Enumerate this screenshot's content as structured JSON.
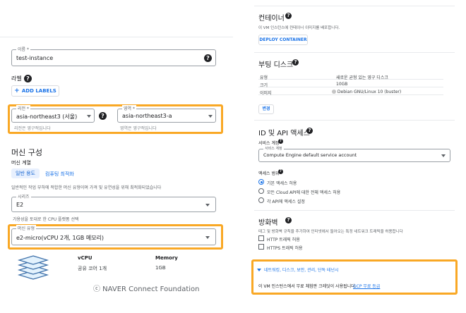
{
  "instance": {
    "name_label": "이름 *",
    "name_value": "test-instance"
  },
  "labels": {
    "title": "라벨",
    "add_button": "ADD LABELS"
  },
  "location": {
    "region_label": "리전 *",
    "region_value": "asia-northeast3 (서울)",
    "region_hint": "리전은 영구적입니다",
    "zone_label": "영역 *",
    "zone_value": "asia-northeast3-a",
    "zone_hint": "영역은 영구적입니다"
  },
  "machine": {
    "section_title": "머신 구성",
    "family_label": "머신 계열",
    "tabs": [
      {
        "label": "일반 용도",
        "selected": true
      },
      {
        "label": "컴퓨팅 최적화",
        "selected": false
      }
    ],
    "family_desc": "일반적인 작업 부하에 적합한 머신 유형이며 가격 및 유연성을 위해 최적화되었습니다",
    "series_label": "시리즈",
    "series_value": "E2",
    "series_desc": "가용성을 토대로 한 CPU 플랫폼 선택",
    "type_label": "머신 유형",
    "type_value": "e2-micro(vCPU 2개, 1GB 메모리)",
    "vcpu_header": "vCPU",
    "vcpu_value": "공유 코어 1개",
    "memory_header": "Memory",
    "memory_value": "1GB"
  },
  "credit": "ⓒ  NAVER Connect Foundation",
  "container": {
    "title": "컨테이너",
    "desc": "이 VM 인스턴스에 컨테이너 이미지를 배포합니다.",
    "deploy_button": "DEPLOY CONTAINER"
  },
  "boot_disk": {
    "title": "부팅 디스크",
    "rows": [
      {
        "key": "유형",
        "value": "새로운 균형 있는 영구 디스크"
      },
      {
        "key": "크기",
        "value": "10GB"
      },
      {
        "key": "이미지",
        "value": "Debian GNU/Linux 10 (buster)"
      }
    ],
    "change_button": "변경"
  },
  "identity": {
    "title": "ID 및 API 액세스",
    "service_account_heading": "서비스 계정",
    "service_account_label": "서비스 계정",
    "service_account_value": "Compute Engine default service account",
    "scope_heading": "액세스 범위",
    "scopes": [
      {
        "label": "기본 액세스 허용",
        "selected": true
      },
      {
        "label": "모든 Cloud API에 대한 전체 액세스 허용",
        "selected": false
      },
      {
        "label": "각 API에 액세스 설정",
        "selected": false
      }
    ]
  },
  "firewall": {
    "title": "방화벽",
    "desc": "태그 및 방화벽 규칙을 추가하여 인터넷에서 들어오는 특정 네트워크 트래픽을 허용합니다",
    "options": [
      {
        "label": "HTTP 트래픽 허용",
        "checked": false
      },
      {
        "label": "HTTPS 트래픽 허용",
        "checked": false
      }
    ]
  },
  "advanced": {
    "expander": "네트워킹, 디스크, 보안, 관리, 단독 테넌시",
    "free_tier_text": "이 VM 인스턴스에서 무료 체험판 크레딧이 사용됩니다.",
    "free_tier_link": "GCP 무료 등급"
  },
  "colors": {
    "accent": "#1a73e8",
    "highlight": "#f9a825",
    "text": "#202124"
  }
}
